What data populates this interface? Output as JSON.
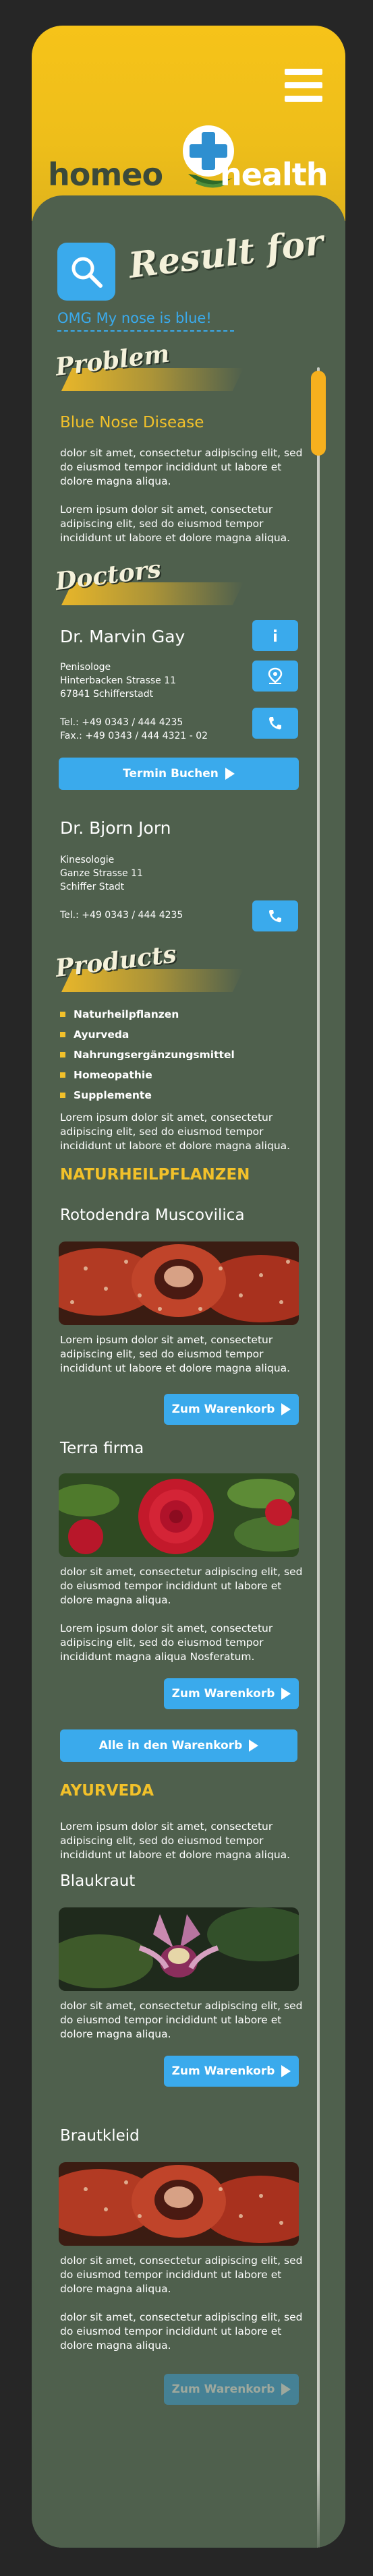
{
  "header": {
    "logo_left": "homeo",
    "logo_right": "health",
    "menu_icon": "hamburger-icon",
    "color": "#f6c319"
  },
  "search": {
    "title": "Result for",
    "query": "OMG My nose is blue!",
    "icon": "search-icon",
    "accent": "#3aaaec"
  },
  "problem": {
    "section_label": "Problem",
    "title": "Blue Nose Disease",
    "para1": "dolor sit amet, consectetur adipiscing elit, sed do eiusmod tempor incididunt ut labore et dolore magna aliqua.",
    "para2": "Lorem ipsum dolor sit amet, consectetur adipiscing elit, sed do eiusmod tempor incididunt ut labore et dolore magna aliqua."
  },
  "doctors": {
    "section_label": "Doctors",
    "list": [
      {
        "name": "Dr. Marvin Gay",
        "specialty": "Penisologe",
        "street": "Hinterbacken Strasse 11",
        "city": "67841 Schifferstadt",
        "tel": "Tel.: +49 0343 / 444 4235",
        "fax": "Fax.: +49 0343 / 444 4321 - 02",
        "icons": [
          "info-icon",
          "location-pin-icon",
          "phone-icon"
        ],
        "book_label": "Termin Buchen"
      },
      {
        "name": "Dr. Bjorn Jorn",
        "specialty": "Kinesologie",
        "street": "Ganze Strasse 11",
        "city": "Schiffer Stadt",
        "tel": "Tel.: +49 0343 / 444 4235",
        "icons": [
          "phone-icon"
        ]
      }
    ]
  },
  "products": {
    "section_label": "Products",
    "categories": [
      "Naturheilpflanzen",
      "Ayurveda",
      "Nahrungsergänzungsmittel",
      "Homeopathie",
      "Supplemente"
    ],
    "intro": "Lorem ipsum dolor sit amet, consectetur adipiscing elit, sed do eiusmod tempor incididunt ut labore et dolore magna aliqua.",
    "cat1": {
      "heading": "NATURHEILPFLANZEN",
      "items": [
        {
          "name": "Rotodendra Muscovilica",
          "text1": "Lorem ipsum dolor sit amet, consectetur adipiscing elit, sed do eiusmod tempor incididunt ut labore et dolore magna aliqua.",
          "button": "Zum Warenkorb"
        },
        {
          "name": "Terra firma",
          "text1": "dolor sit amet, consectetur adipiscing elit, sed do eiusmod tempor incididunt ut labore et dolore magna aliqua.",
          "text2": "Lorem ipsum dolor sit amet, consectetur adipiscing elit, sed do eiusmod tempor incididunt magna aliqua Nosferatum.",
          "button": "Zum Warenkorb"
        }
      ],
      "all_button": "Alle in den Warenkorb"
    },
    "cat2": {
      "heading": "AYURVEDA",
      "intro": "Lorem ipsum dolor sit amet, consectetur adipiscing elit, sed do eiusmod tempor incididunt ut labore et dolore magna aliqua.",
      "items": [
        {
          "name": "Blaukraut",
          "text1": "dolor sit amet, consectetur adipiscing elit, sed do eiusmod tempor incididunt ut labore et dolore magna aliqua.",
          "button": "Zum Warenkorb"
        },
        {
          "name": "Brautkleid",
          "text1": "dolor sit amet, consectetur adipiscing elit, sed do eiusmod tempor incididunt ut labore et dolore magna aliqua.",
          "text2": "dolor sit amet, consectetur adipiscing elit, sed do eiusmod tempor incididunt ut labore et dolore magna aliqua.",
          "button": "Zum Warenkorb"
        }
      ]
    }
  }
}
